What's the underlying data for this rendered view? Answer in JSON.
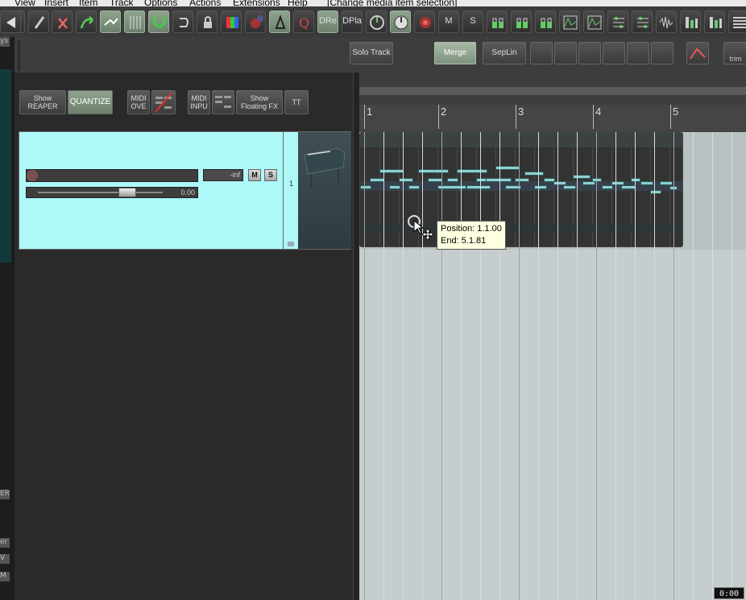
{
  "menubar": {
    "items": [
      "View",
      "Insert",
      "Item",
      "Track",
      "Options",
      "Actions",
      "Extensions",
      "Help"
    ],
    "status": "[Change media item selection]"
  },
  "toolbar": {
    "buttons": [
      {
        "name": "new-project-button",
        "icon": "page-icon"
      },
      {
        "name": "clean-button",
        "icon": "brush-icon"
      },
      {
        "name": "undo-button",
        "icon": "undo-arrow-icon"
      },
      {
        "name": "redo-button",
        "icon": "redo-arrow-icon"
      },
      {
        "name": "ripple-edit-button",
        "icon": "ripple-icon",
        "active": true
      },
      {
        "name": "grid-button",
        "icon": "grid-icon",
        "active": true
      },
      {
        "name": "snap-button",
        "icon": "magnet-icon",
        "active": true
      },
      {
        "name": "loop-button",
        "icon": "loop-icon"
      },
      {
        "name": "lock-button",
        "icon": "lock-icon"
      },
      {
        "name": "color-button",
        "icon": "color-swatch-icon"
      },
      {
        "name": "record-mode-button",
        "icon": "record-mode-icon"
      },
      {
        "name": "metronome-button",
        "icon": "metronome-icon",
        "active": true
      },
      {
        "name": "quantize-tool-button",
        "icon": "q-icon"
      },
      {
        "name": "dre-button",
        "label": "DRe",
        "active": true
      },
      {
        "name": "dpla-button",
        "label": "DPla"
      },
      {
        "name": "meter-button",
        "icon": "meter-icon"
      },
      {
        "name": "dial-button",
        "icon": "dial-icon",
        "active": true
      },
      {
        "name": "record-button",
        "icon": "record-icon"
      },
      {
        "name": "mute-button",
        "label": "M"
      },
      {
        "name": "solo-button",
        "label": "S"
      },
      {
        "name": "link-a-button",
        "icon": "link-icon"
      },
      {
        "name": "link-b-button",
        "icon": "link-icon"
      },
      {
        "name": "link-c-button",
        "icon": "link-icon"
      },
      {
        "name": "env-1-button",
        "icon": "envelope-icon"
      },
      {
        "name": "env-2-button",
        "icon": "envelope-icon"
      },
      {
        "name": "routing-a-button",
        "icon": "routing-icon"
      },
      {
        "name": "routing-b-button",
        "icon": "routing-icon"
      },
      {
        "name": "waveform-button",
        "icon": "waveform-icon"
      },
      {
        "name": "mixer-a-button",
        "icon": "mixer-icon"
      },
      {
        "name": "mixer-b-button",
        "icon": "mixer-icon"
      },
      {
        "name": "list-button",
        "icon": "list-icon"
      },
      {
        "name": "collapse-button",
        "icon": "triangle-left-icon"
      }
    ]
  },
  "toolbar2": {
    "solo_track": "Solo Track",
    "merge": "Merge",
    "seplin": "SepLin",
    "trim": "trim"
  },
  "left_strip": {
    "top_label": "ys",
    "mid_label": "ER",
    "bottom_labels": [
      "er",
      "V",
      "M"
    ]
  },
  "tcp_toolbar": {
    "show_reaper": "Show REAPER",
    "quantize": "QUANTIZE",
    "midi_ove": "MIDI OVE",
    "midi_inpu": "MIDI INPU",
    "show_floating_fx": "Show Floating FX",
    "tt": "TT"
  },
  "track": {
    "volume_readout": "-inf",
    "mute": "M",
    "solo": "S",
    "pan_value": "0.00",
    "number": "1"
  },
  "ruler": {
    "bars": [
      "1",
      "2",
      "3",
      "4",
      "5"
    ]
  },
  "tooltip": {
    "position": "Position: 1.1.00",
    "end": "End: 5.1.81"
  },
  "time_badge": "0:00",
  "colors": {
    "track_selected": "#aef8f8",
    "midi_note": "#8ed0d2",
    "active_button": "#8fa48f"
  }
}
